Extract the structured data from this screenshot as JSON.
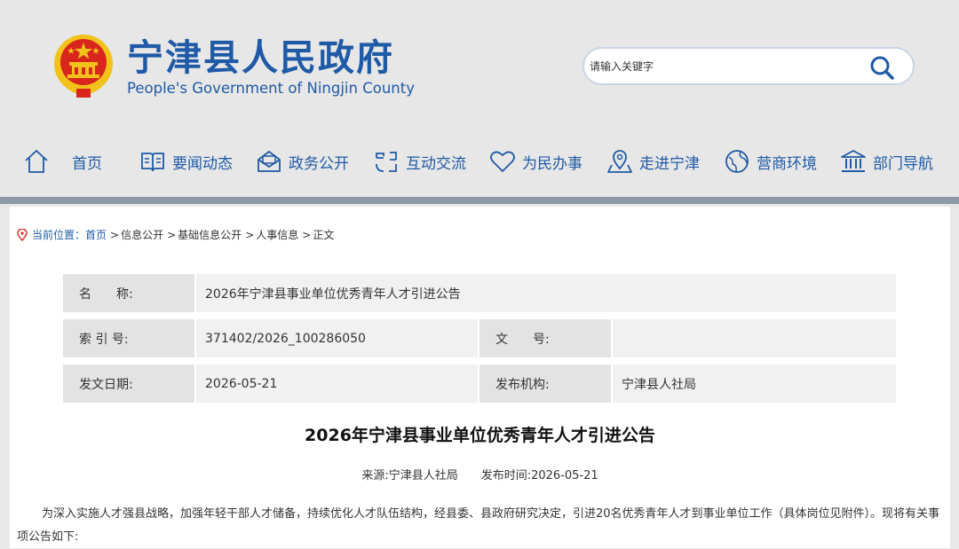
{
  "header": {
    "title": "宁津县人民政府",
    "subtitle": "People's Government of Ningjin County",
    "search_placeholder": "请输入关键字"
  },
  "nav": {
    "items": [
      {
        "label": "首页",
        "icon": "home-icon"
      },
      {
        "label": "要闻动态",
        "icon": "book-icon"
      },
      {
        "label": "政务公开",
        "icon": "mail-icon"
      },
      {
        "label": "互动交流",
        "icon": "interact-icon"
      },
      {
        "label": "为民办事",
        "icon": "heart-icon"
      },
      {
        "label": "走进宁津",
        "icon": "map-pin-icon"
      },
      {
        "label": "营商环境",
        "icon": "globe-icon"
      },
      {
        "label": "部门导航",
        "icon": "building-icon"
      }
    ]
  },
  "breadcrumb": {
    "prefix": "当前位置：",
    "items": [
      "首页",
      "信息公开",
      "基础信息公开",
      "人事信息",
      "正文"
    ],
    "separator": ">"
  },
  "info": {
    "name_label": "名　　称:",
    "name_value": "2026年宁津县事业单位优秀青年人才引进公告",
    "index_label": "索 引 号:",
    "index_value": "371402/2026_100286050",
    "docno_label": "文　　号:",
    "docno_value": "",
    "date_label": "发文日期:",
    "date_value": "2026-05-21",
    "org_label": "发布机构:",
    "org_value": "宁津县人社局"
  },
  "article": {
    "title": "2026年宁津县事业单位优秀青年人才引进公告",
    "source": "来源:宁津县人社局",
    "publish_time": "发布时间:2026-05-21",
    "body": "为深入实施人才强县战略，加强年轻干部人才储备，持续优化人才队伍结构，经县委、县政府研究决定，引进20名优秀青年人才到事业单位工作（具体岗位见附件）。现将有关事项公告如下:"
  },
  "colors": {
    "brand_blue": "#1f5aa6",
    "header_bg": "#e7e7e7",
    "divider": "#8e99a8",
    "emblem_red": "#d9261c",
    "emblem_gold": "#f2c21b"
  }
}
